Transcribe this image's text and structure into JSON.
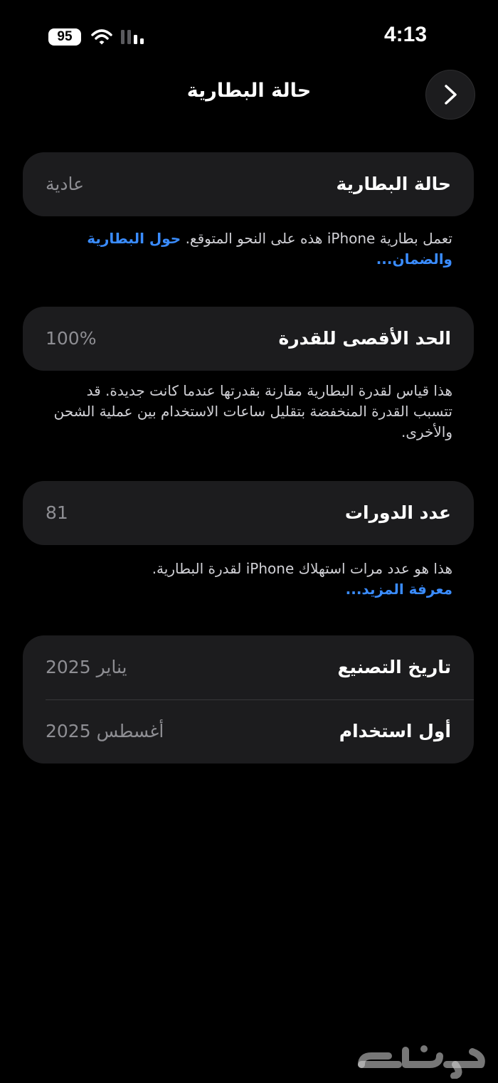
{
  "status_bar": {
    "time": "4:13",
    "battery_level": "95",
    "icons": [
      "wifi-icon",
      "cellular-signal-icon"
    ]
  },
  "nav": {
    "title": "حالة البطارية",
    "back_icon": "chevron-right-icon"
  },
  "sections": {
    "health": {
      "label": "حالة البطارية",
      "value": "عادية",
      "footnote": "تعمل بطارية iPhone هذه على النحو المتوقع.",
      "link": "حول البطارية والضمان..."
    },
    "max_capacity": {
      "label": "الحد الأقصى للقدرة",
      "value": "100%",
      "footnote": "هذا قياس لقدرة البطارية مقارنة بقدرتها عندما كانت جديدة. قد تتسبب القدرة المنخفضة بتقليل ساعات الاستخدام بين عملية الشحن والأخرى."
    },
    "cycle_count": {
      "label": "عدد الدورات",
      "value": "81",
      "footnote": "هذا هو عدد مرات استهلاك iPhone لقدرة البطارية.",
      "link": "معرفة المزيد..."
    },
    "dates": {
      "manufacture_label": "تاريخ التصنيع",
      "manufacture_value": "يناير 2025",
      "first_use_label": "أول استخدام",
      "first_use_value": "أغسطس 2025"
    }
  },
  "watermark": {
    "text": "حراج"
  },
  "colors": {
    "background": "#000000",
    "card": "#1c1c1e",
    "secondary_text": "#8e8e93",
    "link": "#3a8cff"
  }
}
